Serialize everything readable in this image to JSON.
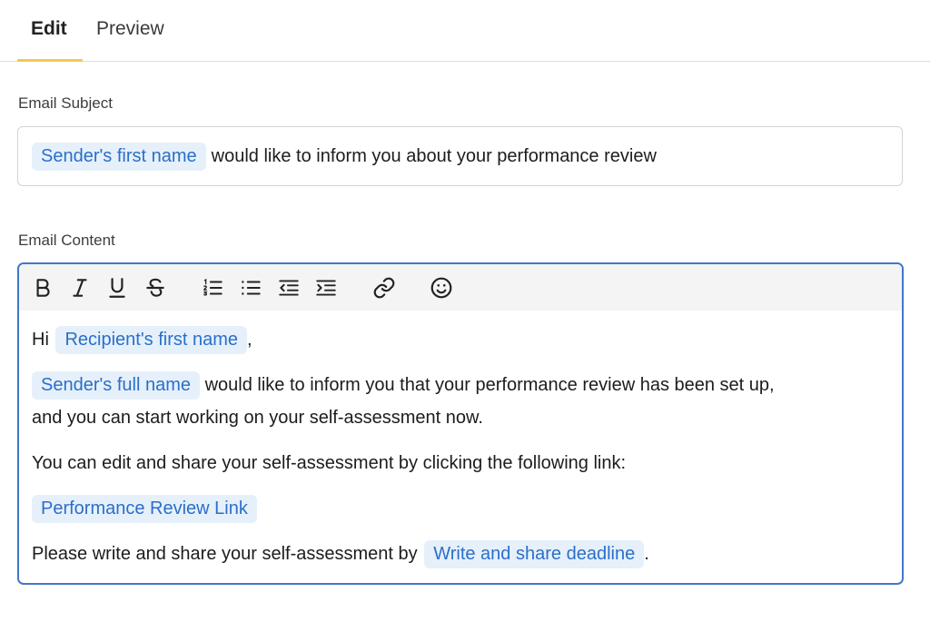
{
  "tabs": [
    {
      "label": "Edit",
      "active": true
    },
    {
      "label": "Preview",
      "active": false
    }
  ],
  "subject": {
    "label": "Email Subject",
    "chip": "Sender's first name",
    "text": "would like to inform you about your performance review"
  },
  "content": {
    "label": "Email Content",
    "toolbar": [
      "bold-icon",
      "italic-icon",
      "underline-icon",
      "strikethrough-icon",
      "ordered-list-icon",
      "bullet-list-icon",
      "outdent-icon",
      "indent-icon",
      "link-icon",
      "emoji-icon"
    ],
    "greeting_prefix": "Hi",
    "greeting_chip": "Recipient's first name",
    "greeting_suffix": ",",
    "para1_chip": "Sender's full name",
    "para1_text": "would like to inform you that your performance review has been set up,",
    "para1_text2": "and you can start working on your self-assessment now.",
    "para2_text": "You can edit and share your self-assessment by clicking the following link:",
    "link_chip": "Performance Review Link",
    "para4_text": "Please write and share your self-assessment by",
    "para4_chip": "Write and share deadline",
    "para4_suffix": "."
  },
  "colors": {
    "accent_underline": "#f2c94c",
    "chip_bg": "#e6f0fb",
    "chip_text": "#2a6fc9",
    "editor_border": "#3f78c9"
  }
}
